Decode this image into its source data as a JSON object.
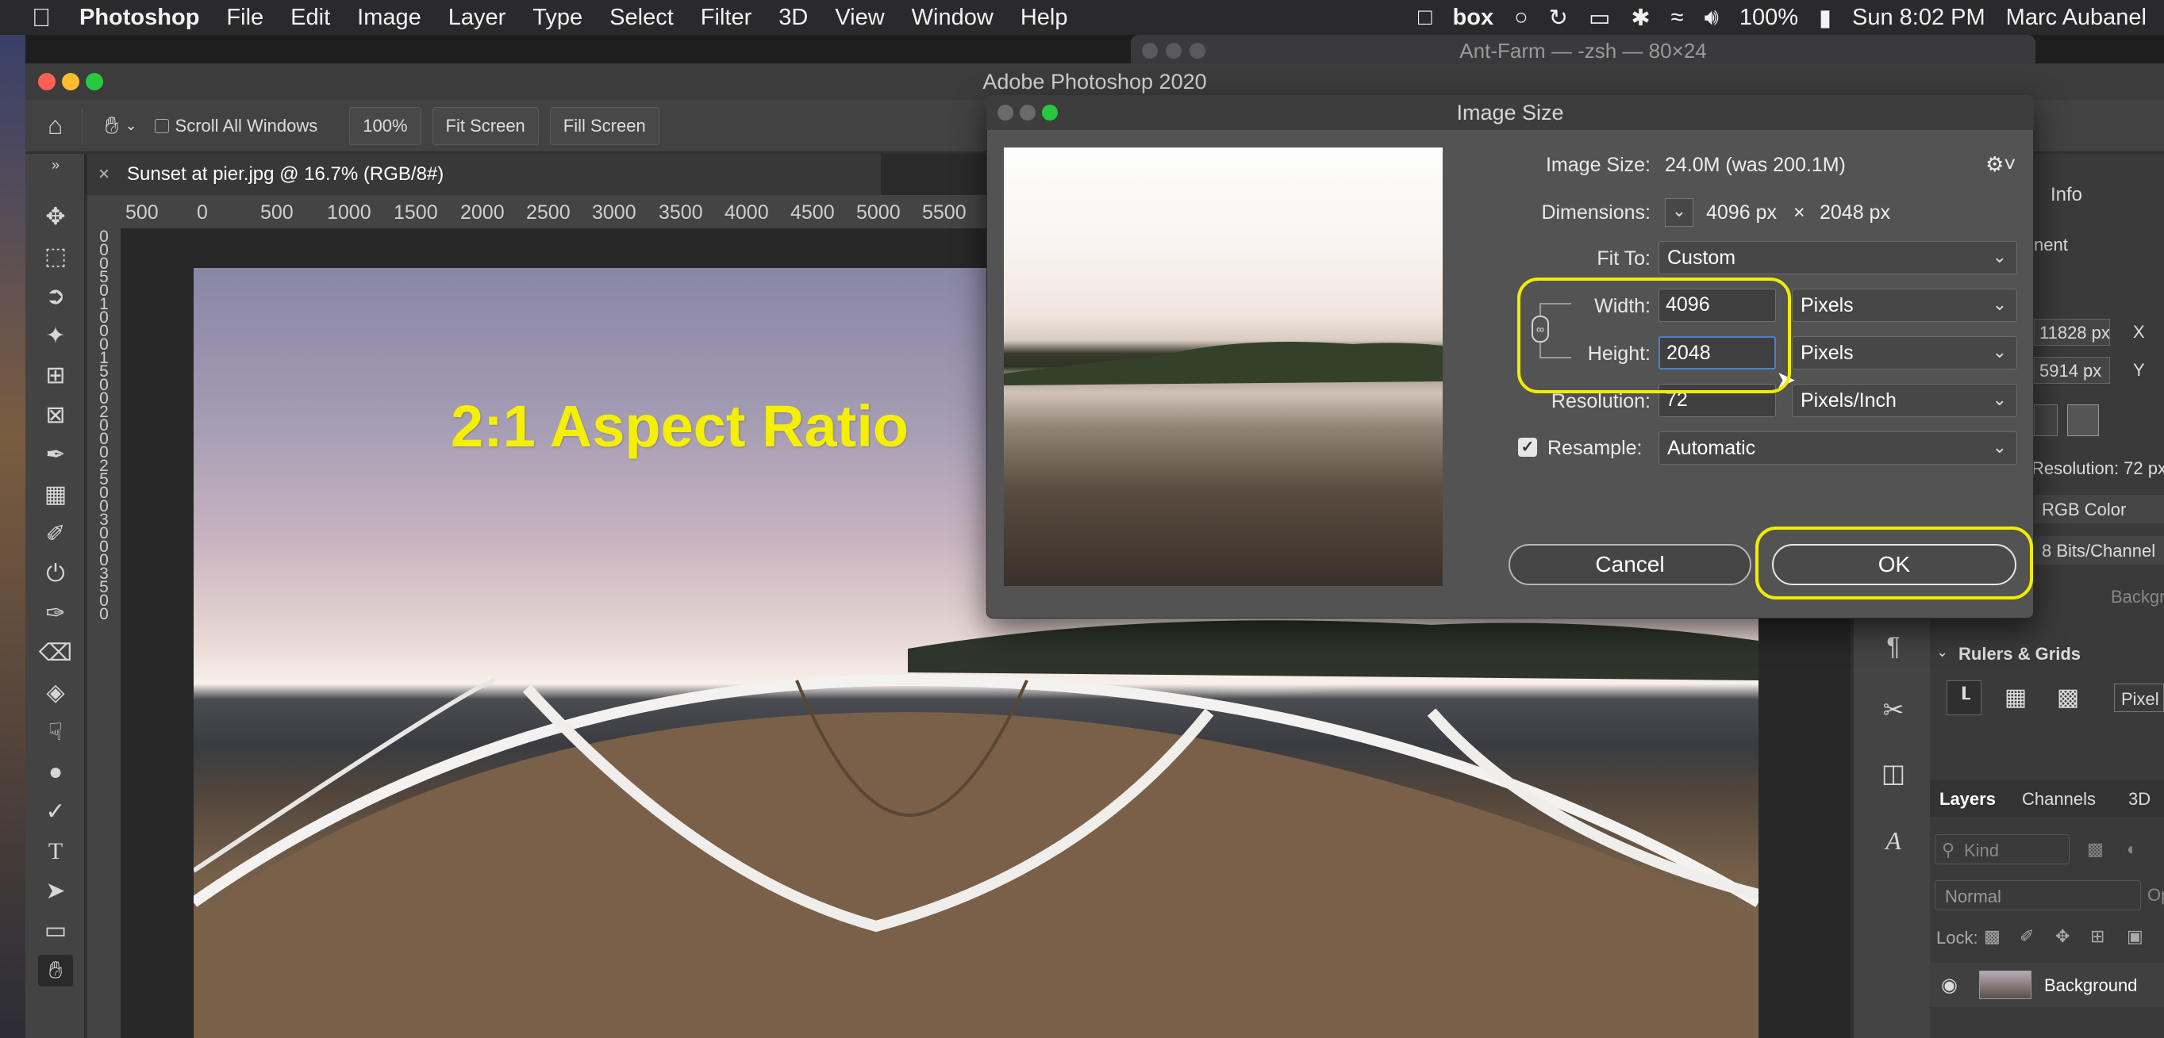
{
  "menubar": {
    "app_name": "Photoshop",
    "items": [
      "File",
      "Edit",
      "Image",
      "Layer",
      "Type",
      "Select",
      "Filter",
      "3D",
      "View",
      "Window",
      "Help"
    ],
    "battery": "100%",
    "clock": "Sun 8:02 PM",
    "user": "Marc Aubanel",
    "box_label": "box"
  },
  "terminal": {
    "title": "Ant-Farm — -zsh — 80×24"
  },
  "window": {
    "title": "Adobe Photoshop 2020"
  },
  "options_bar": {
    "scroll_all": "Scroll All Windows",
    "zoom": "100%",
    "fit_screen": "Fit Screen",
    "fill_screen": "Fill Screen"
  },
  "document": {
    "tab": "Sunset at pier.jpg @ 16.7% (RGB/8#)",
    "overlay_text": "2:1 Aspect Ratio"
  },
  "ruler": {
    "top_ticks": [
      "500",
      "0",
      "500",
      "1000",
      "1500",
      "2000",
      "2500",
      "3000",
      "3500",
      "4000",
      "4500",
      "5000",
      "5500"
    ],
    "left_ticks": [
      "0",
      "0",
      "0",
      "5",
      "0",
      "1",
      "0",
      "0",
      "0",
      "1",
      "5",
      "0",
      "0",
      "2",
      "0",
      "0",
      "0",
      "2",
      "5",
      "0",
      "0",
      "3",
      "0",
      "0",
      "0",
      "3",
      "5",
      "0",
      "0"
    ]
  },
  "dialog": {
    "title": "Image Size",
    "image_size_label": "Image Size:",
    "image_size_value": "24.0M (was 200.1M)",
    "dimensions_label": "Dimensions:",
    "dimensions_w": "4096 px",
    "dimensions_x": "×",
    "dimensions_h": "2048 px",
    "fit_to_label": "Fit To:",
    "fit_to_value": "Custom",
    "width_label": "Width:",
    "width_value": "4096",
    "width_unit": "Pixels",
    "height_label": "Height:",
    "height_value": "2048",
    "height_unit": "Pixels",
    "resolution_label": "Resolution:",
    "resolution_value": "72",
    "resolution_unit": "Pixels/Inch",
    "resample_label": "Resample:",
    "resample_checked": true,
    "resample_value": "Automatic",
    "cancel": "Cancel",
    "ok": "OK",
    "highlight_color": "#f2ec00"
  },
  "right_panel": {
    "info_tab": "Info",
    "adjust_partial": "nent",
    "x_value": "11828 px",
    "x_label": "X",
    "y_value": "5914 px",
    "y_label": "Y",
    "resolution_text": "Resolution: 72 px",
    "color_mode": "RGB Color",
    "bit_depth": "8 Bits/Channel",
    "background_partial": "Backgroun",
    "rulers_grids": "Rulers & Grids",
    "pixels_partial": "Pixel",
    "layers_tab": "Layers",
    "channels_tab": "Channels",
    "threed_tab": "3D",
    "kind_placeholder": "Kind",
    "blend_mode": "Normal",
    "opacity_partial": "Op",
    "lock_label": "Lock:",
    "layer_name": "Background"
  }
}
